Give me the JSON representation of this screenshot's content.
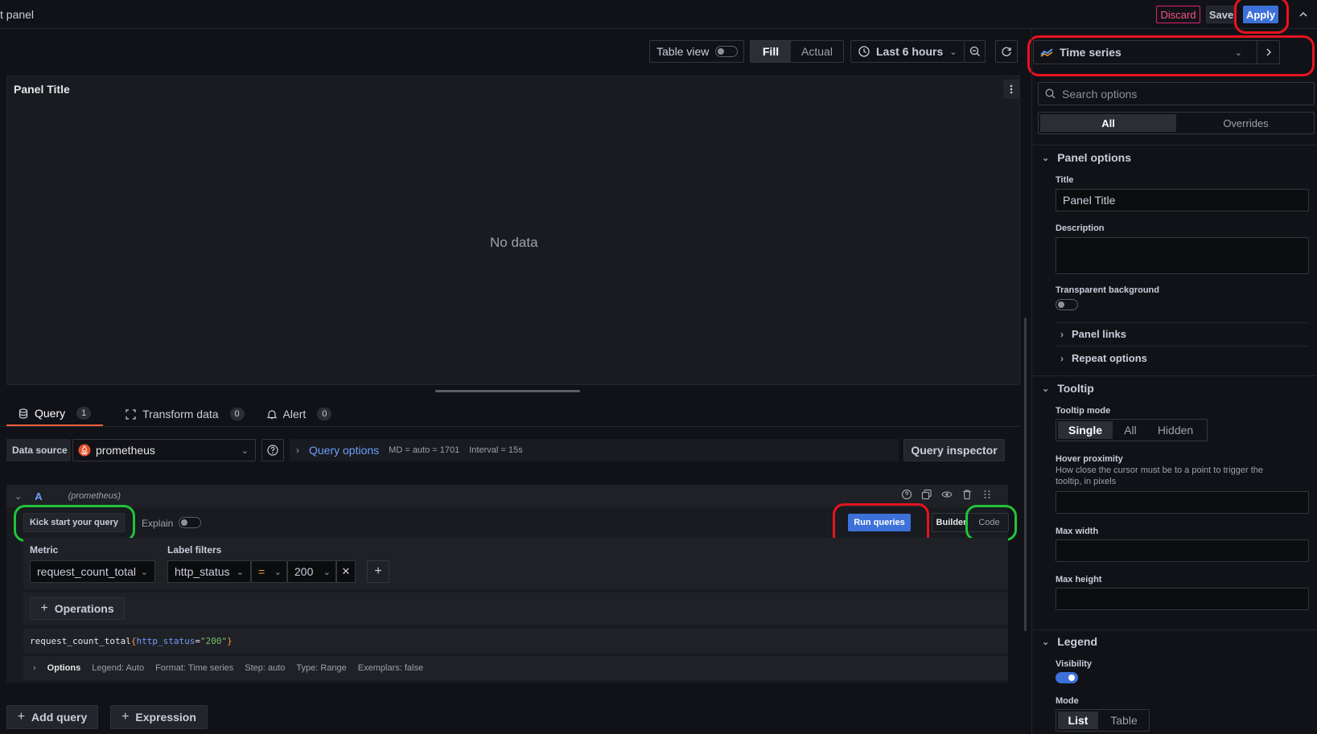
{
  "header": {
    "title": "t panel",
    "discard_label": "Discard",
    "save_label": "Save",
    "apply_label": "Apply"
  },
  "toolbar": {
    "table_view_label": "Table view",
    "fill_label": "Fill",
    "actual_label": "Actual",
    "time_range": "Last 6 hours"
  },
  "viz_picker": {
    "selected": "Time series"
  },
  "panel": {
    "title": "Panel Title",
    "empty_text": "No data"
  },
  "query_tabs": [
    {
      "label": "Query",
      "count": "1"
    },
    {
      "label": "Transform data",
      "count": "0"
    },
    {
      "label": "Alert",
      "count": "0"
    }
  ],
  "datasource": {
    "label": "Data source",
    "value": "prometheus",
    "query_options_label": "Query options",
    "md_info": "MD = auto = 1701",
    "interval_info": "Interval = 15s",
    "inspector_label": "Query inspector"
  },
  "query_row": {
    "ref_id": "A",
    "source": "(prometheus)",
    "kick_start_label": "Kick start your query",
    "explain_label": "Explain",
    "run_label": "Run queries",
    "builder_label": "Builder",
    "code_label": "Code",
    "metric_label": "Metric",
    "metric_value": "request_count_total",
    "label_filters_label": "Label filters",
    "filter_key": "http_status",
    "filter_op": "=",
    "filter_value": "200",
    "operations_label": "Operations",
    "preview_metric": "request_count_total",
    "preview_open": "{",
    "preview_key": "http_status",
    "preview_eq": "=",
    "preview_val": "\"200\"",
    "preview_close": "}",
    "options_label": "Options",
    "opt_legend": "Legend: Auto",
    "opt_format": "Format: Time series",
    "opt_step": "Step: auto",
    "opt_type": "Type: Range",
    "opt_exemplars": "Exemplars: false"
  },
  "bottom": {
    "add_query_label": "Add query",
    "expression_label": "Expression"
  },
  "options_pane": {
    "search_placeholder": "Search options",
    "tab_all": "All",
    "tab_overrides": "Overrides",
    "panel_options": "Panel options",
    "title_label": "Title",
    "title_value": "Panel Title",
    "description_label": "Description",
    "transparent_label": "Transparent background",
    "panel_links": "Panel links",
    "repeat_options": "Repeat options",
    "tooltip_section": "Tooltip",
    "tooltip_mode_label": "Tooltip mode",
    "tooltip_modes": [
      "Single",
      "All",
      "Hidden"
    ],
    "hover_label": "Hover proximity",
    "hover_desc_1": "How close the cursor must be to a point to trigger the",
    "hover_desc_2": "tooltip, in pixels",
    "max_width_label": "Max width",
    "max_height_label": "Max height",
    "legend_section": "Legend",
    "visibility_label": "Visibility",
    "mode_label": "Mode",
    "modes": [
      "List",
      "Table"
    ]
  },
  "colors": {
    "accent_blue": "#3d71d9",
    "annotation_red": "#e8131f",
    "annotation_green": "#22c33a",
    "query_tab_underline": "#f55f3e"
  }
}
